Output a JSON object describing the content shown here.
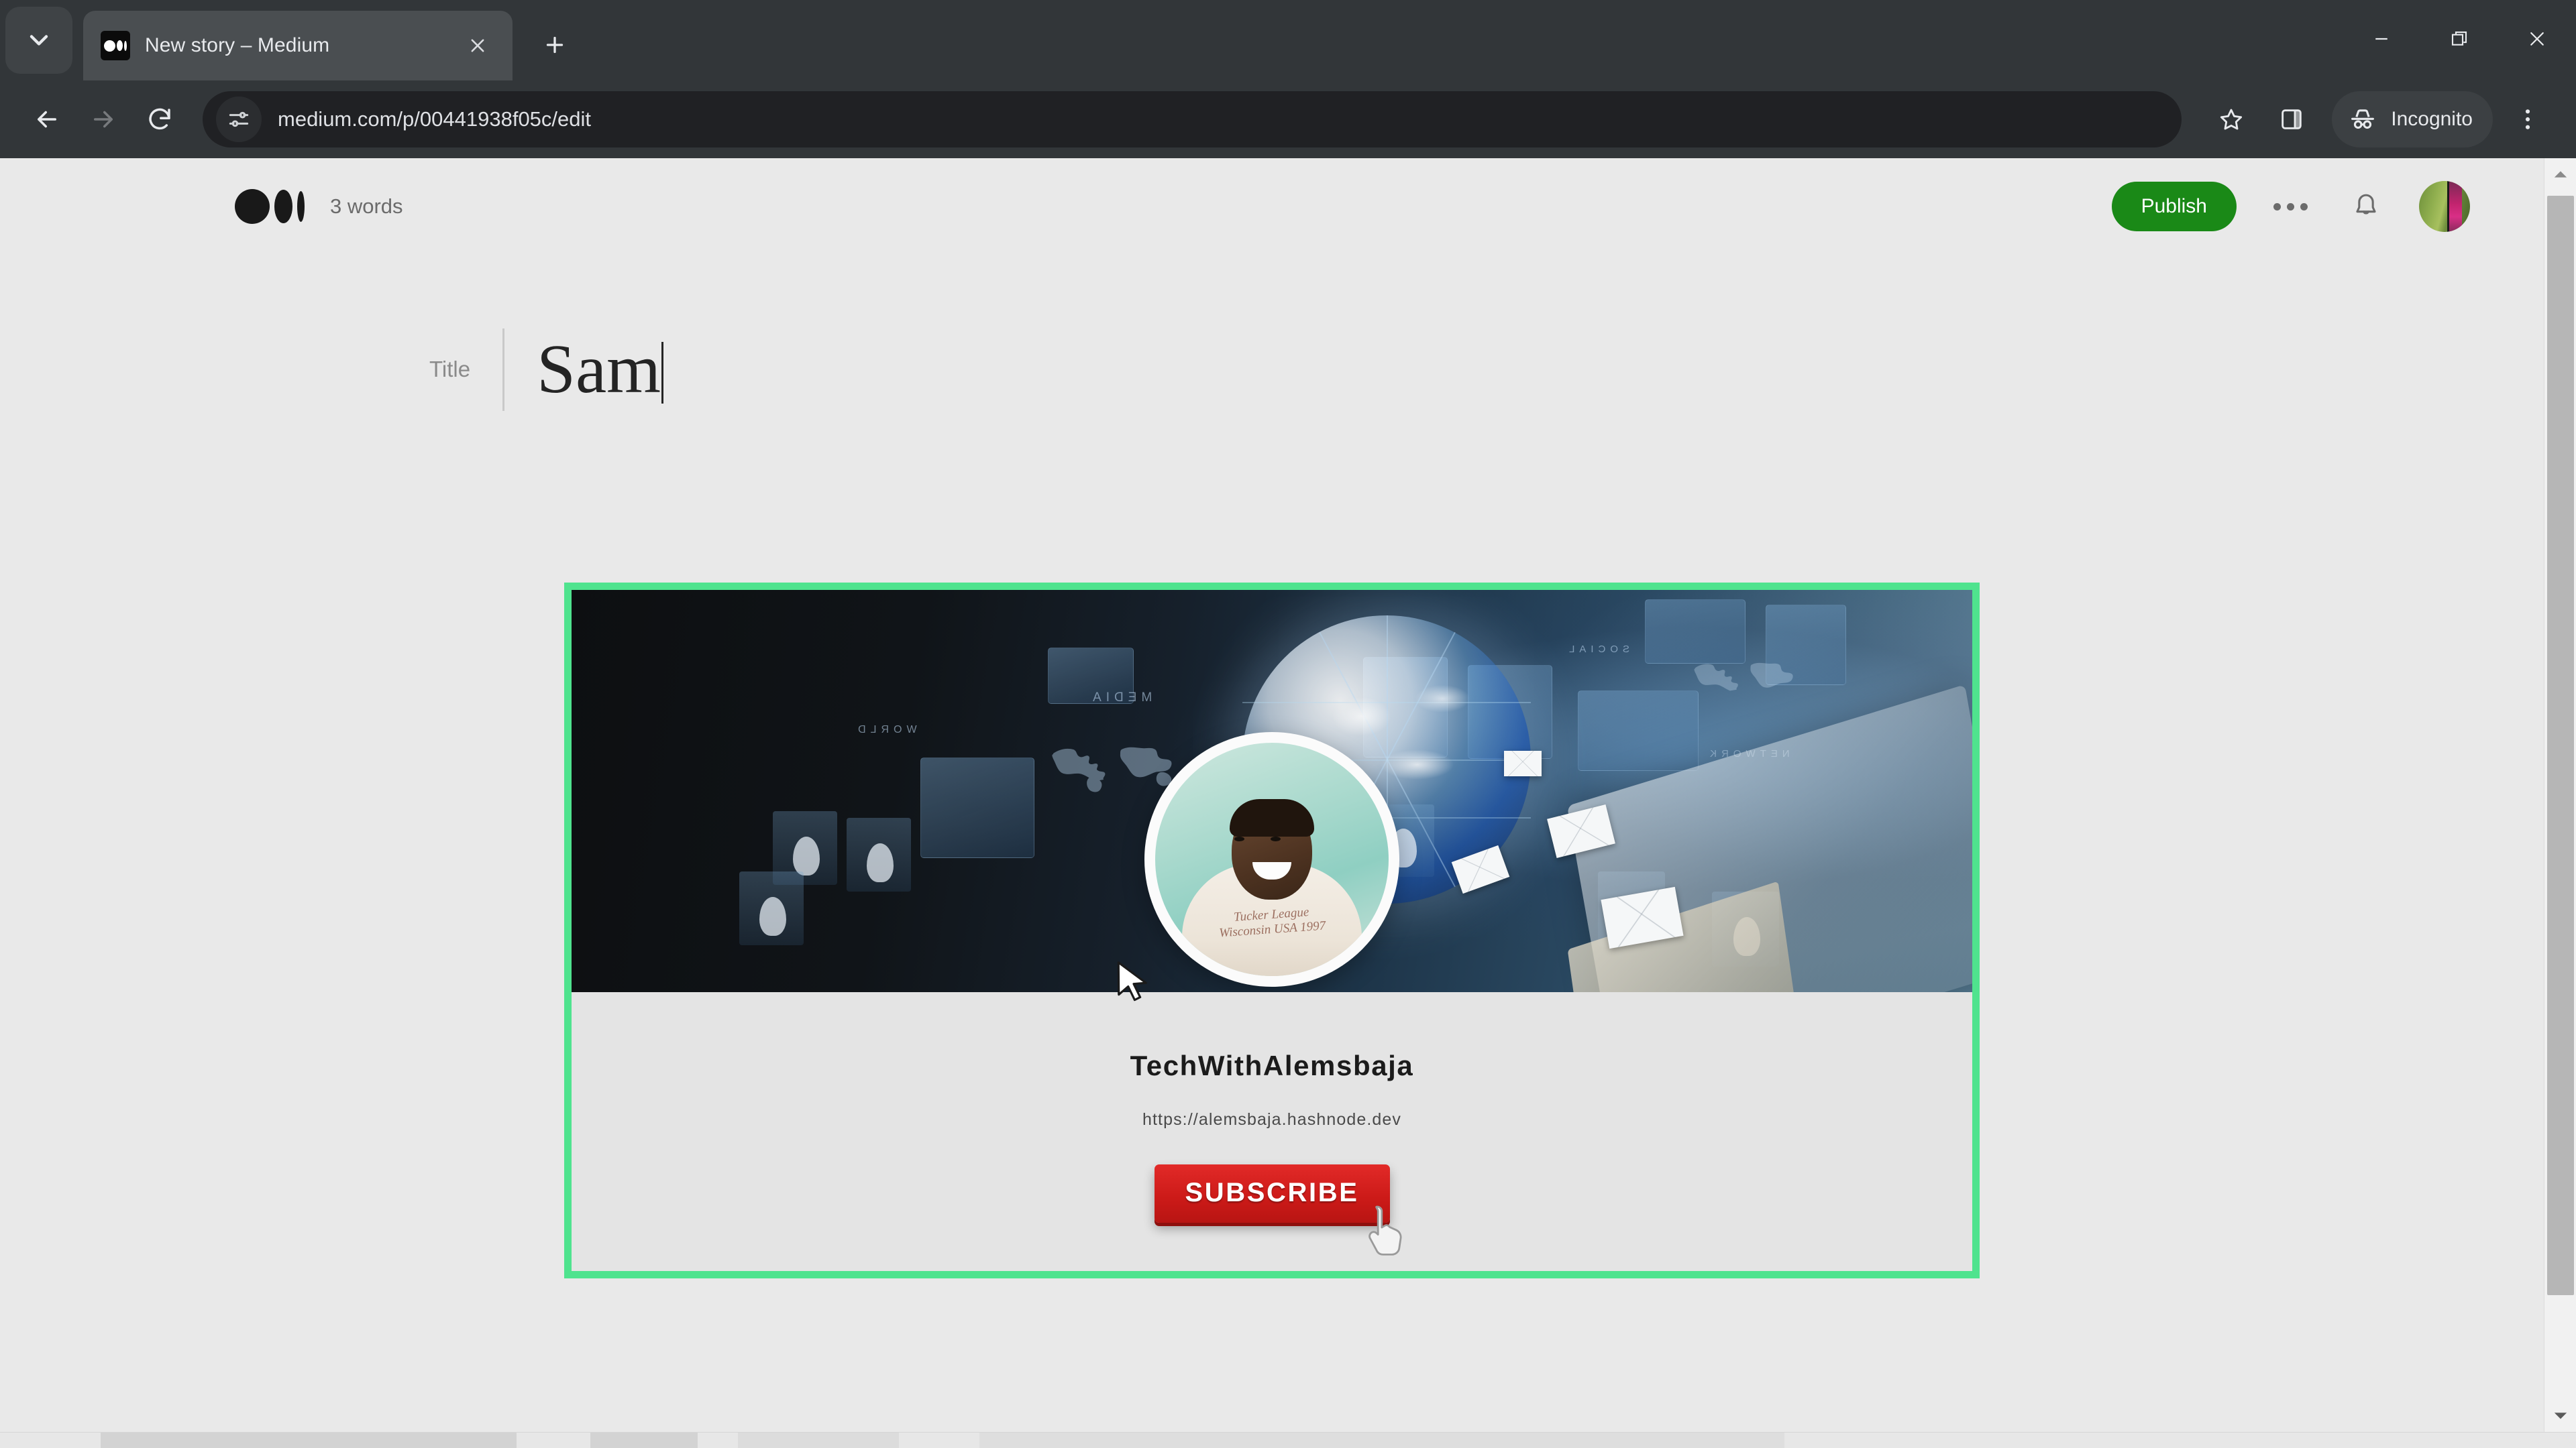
{
  "browser": {
    "tab": {
      "title": "New story – Medium",
      "favicon": "medium-logo-icon"
    },
    "url": "medium.com/p/00441938f05c/edit",
    "profile_label": "Incognito",
    "icons": {
      "tab_search": "chevron-down-icon",
      "new_tab": "plus-icon",
      "close_tab": "close-icon",
      "back": "arrow-left-icon",
      "forward": "arrow-right-icon",
      "reload": "reload-icon",
      "site_info": "tune-settings-icon",
      "bookmark": "star-icon",
      "side_panel": "side-panel-icon",
      "incognito": "incognito-hat-icon",
      "menu": "three-dot-vertical-icon",
      "minimize": "minimize-icon",
      "maximize": "restore-window-icon",
      "close_window": "close-window-icon"
    }
  },
  "editor": {
    "logo": "medium-logo-icon",
    "word_count": "3 words",
    "publish_label": "Publish",
    "more_options": "three-dot-horizontal-icon",
    "notifications": "bell-icon",
    "avatar": "user-avatar",
    "title_label": "Title",
    "title_value": "Sam"
  },
  "embed_card": {
    "selected": true,
    "selection_color": "#4fe38e",
    "banner": {
      "alt": "digital-network-banner",
      "overlay_texts": [
        "MEDIA",
        "WORLD",
        "SOCIAL",
        "NETWORK"
      ]
    },
    "profile_name": "TechWithAlemsbaja",
    "profile_url": "https://alemsbaja.hashnode.dev",
    "subscribe_label": "SUBSCRIBE",
    "subscribe_color": "#cc1a18",
    "shirt_text": "Tucker League Wisconsin USA 1997"
  },
  "scrollbar": {
    "up_arrow": "chevron-up-icon",
    "down_arrow": "chevron-down-icon"
  }
}
